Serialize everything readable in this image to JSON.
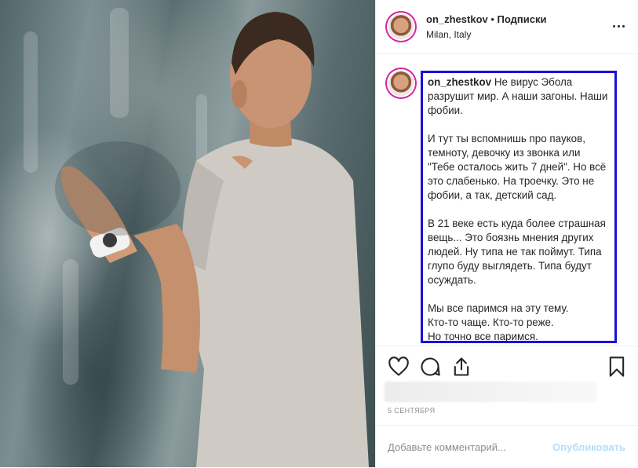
{
  "post": {
    "username": "on_zhestkov",
    "separator": " • ",
    "follow_label": "Подписки",
    "location": "Milan, Italy"
  },
  "caption": {
    "username": "on_zhestkov",
    "paragraphs": [
      "Не вирус Эбола разрушит мир. А наши загоны. Наши фобии.",
      "И тут ты вспомнишь про пауков, темноту, девочку из звонка или \"Тебе осталось жить 7 дней\". Но всё это слабенько. На троечку. Это не фобии, а так, детский сад.",
      "В 21 веке есть куда более страшная вещь... Это боязнь мнения других людей. Ну типа не так поймут. Типа глупо буду выглядеть. Типа будут осуждать.",
      "Мы все паримся на эту тему.\nКто-то чаще. Кто-то реже.\nНо точно все паримся."
    ]
  },
  "date": "5 СЕНТЯБРЯ",
  "comment_box": {
    "placeholder": "Добавьте комментарий...",
    "publish_label": "Опубликовать"
  },
  "colors": {
    "highlight_box": "#1a10d8",
    "publish_disabled": "#b2dffc",
    "story_ring": "#d6249f"
  },
  "icons": [
    "heart-icon",
    "comment-icon",
    "share-icon",
    "bookmark-icon",
    "more-icon"
  ]
}
